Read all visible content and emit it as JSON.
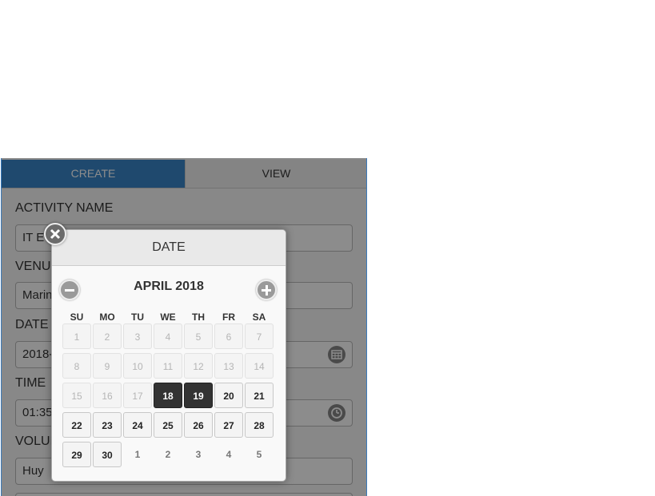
{
  "tabs": {
    "create": "CREATE",
    "view": "VIEW"
  },
  "form": {
    "activity_name_label": "ACTIVITY NAME",
    "activity_name_value": "IT E",
    "venue_label": "VENUE",
    "venue_value": "Marin",
    "date_label": "DATE",
    "date_value": "2018-",
    "time_label": "TIME",
    "time_value": "01:35",
    "volunteer_label": "VOLUN",
    "volunteer_value": "Huy"
  },
  "datepicker": {
    "header": "DATE",
    "month_year": "APRIL 2018",
    "weekdays": [
      "SU",
      "MO",
      "TU",
      "WE",
      "TH",
      "FR",
      "SA"
    ],
    "weeks": [
      [
        {
          "d": "1",
          "s": "muted"
        },
        {
          "d": "2",
          "s": "muted"
        },
        {
          "d": "3",
          "s": "muted"
        },
        {
          "d": "4",
          "s": "muted"
        },
        {
          "d": "5",
          "s": "muted"
        },
        {
          "d": "6",
          "s": "muted"
        },
        {
          "d": "7",
          "s": "muted"
        }
      ],
      [
        {
          "d": "8",
          "s": "muted"
        },
        {
          "d": "9",
          "s": "muted"
        },
        {
          "d": "10",
          "s": "muted"
        },
        {
          "d": "11",
          "s": "muted"
        },
        {
          "d": "12",
          "s": "muted"
        },
        {
          "d": "13",
          "s": "muted"
        },
        {
          "d": "14",
          "s": "muted"
        }
      ],
      [
        {
          "d": "15",
          "s": "muted"
        },
        {
          "d": "16",
          "s": "muted"
        },
        {
          "d": "17",
          "s": "muted"
        },
        {
          "d": "18",
          "s": "selected"
        },
        {
          "d": "19",
          "s": "selected"
        },
        {
          "d": "20",
          "s": "active"
        },
        {
          "d": "21",
          "s": "active"
        }
      ],
      [
        {
          "d": "22",
          "s": "active"
        },
        {
          "d": "23",
          "s": "active"
        },
        {
          "d": "24",
          "s": "active"
        },
        {
          "d": "25",
          "s": "active"
        },
        {
          "d": "26",
          "s": "active"
        },
        {
          "d": "27",
          "s": "active"
        },
        {
          "d": "28",
          "s": "active"
        }
      ],
      [
        {
          "d": "29",
          "s": "active"
        },
        {
          "d": "30",
          "s": "active"
        },
        {
          "d": "1",
          "s": "next"
        },
        {
          "d": "2",
          "s": "next"
        },
        {
          "d": "3",
          "s": "next"
        },
        {
          "d": "4",
          "s": "next"
        },
        {
          "d": "5",
          "s": "next"
        }
      ]
    ]
  },
  "icons": {
    "close": "close-icon",
    "prev": "minus-icon",
    "next": "plus-icon",
    "calendar": "calendar-icon",
    "clock": "clock-icon"
  },
  "colors": {
    "accent": "#3a86c8",
    "selected_day": "#333333"
  }
}
